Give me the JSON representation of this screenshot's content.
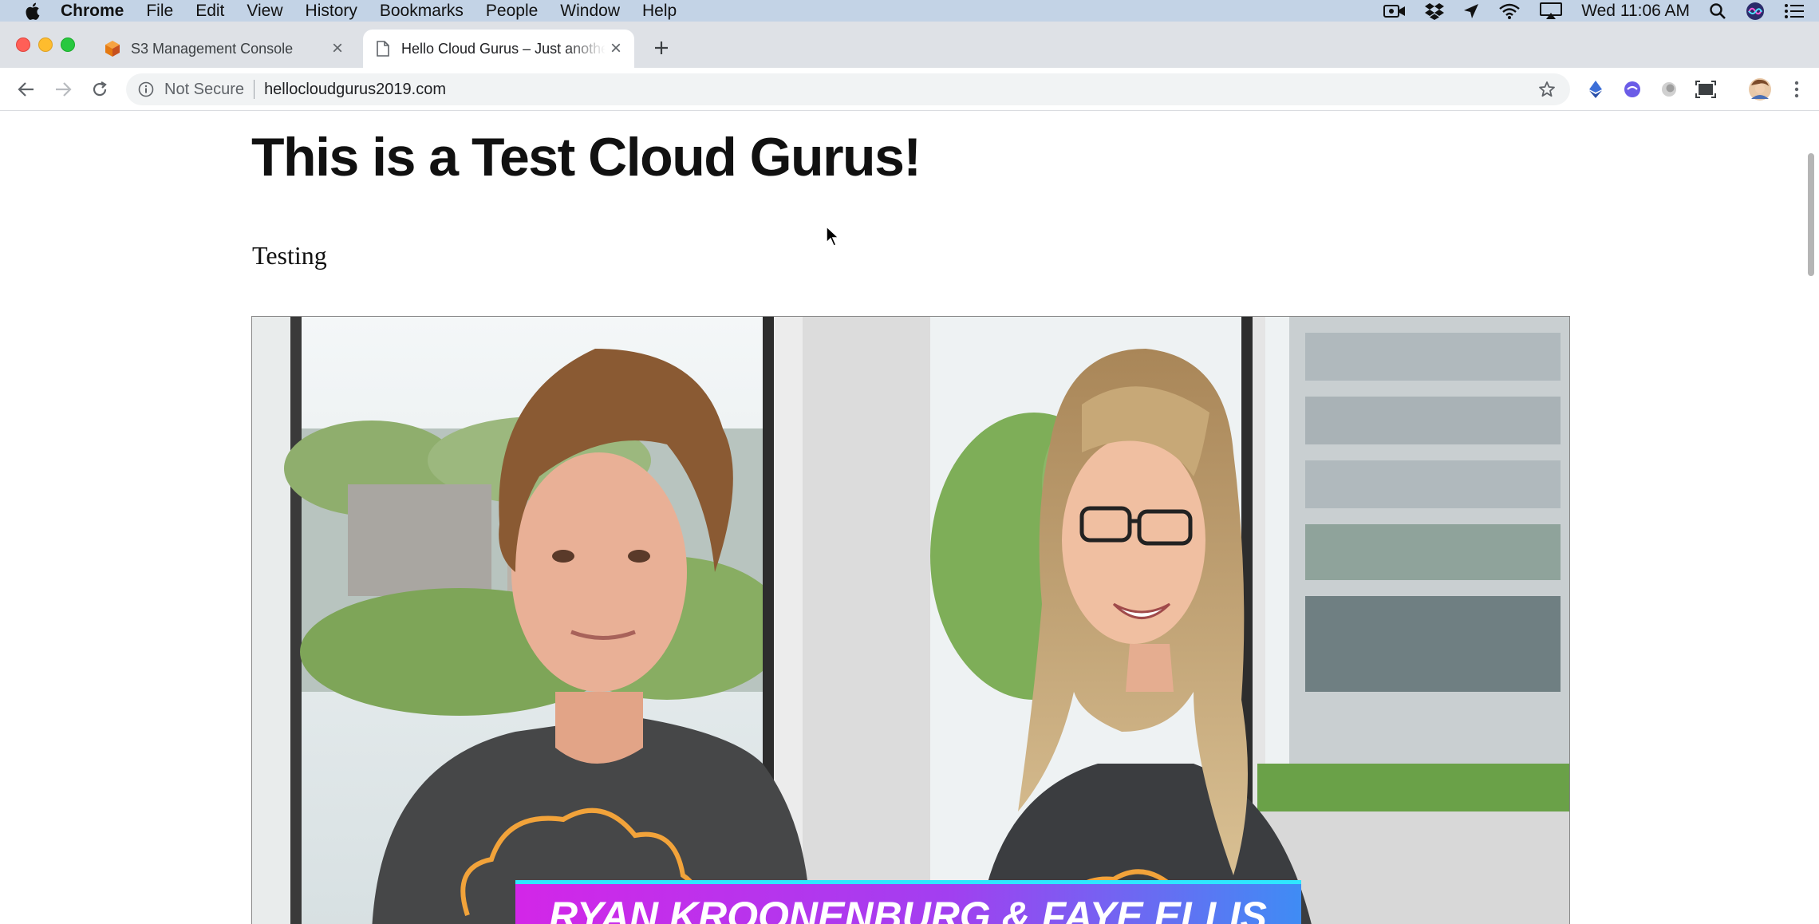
{
  "menubar": {
    "app_name": "Chrome",
    "menus": [
      "File",
      "Edit",
      "View",
      "History",
      "Bookmarks",
      "People",
      "Window",
      "Help"
    ],
    "clock": "Wed 11:06 AM",
    "status_icons": [
      "facetime-icon",
      "dropbox-icon",
      "location-icon",
      "wifi-icon",
      "airplay-icon",
      "spotlight-icon",
      "siri-icon",
      "notification-center-icon"
    ]
  },
  "tabs": [
    {
      "title": "S3 Management Console",
      "favicon": "aws-cube-icon",
      "active": false
    },
    {
      "title": "Hello Cloud Gurus – Just another",
      "favicon": "page-icon",
      "active": true
    }
  ],
  "toolbar": {
    "security_label": "Not Secure",
    "url": "hellocloudgurus2019.com"
  },
  "page": {
    "heading": "This is a Test Cloud Gurus!",
    "paragraph": "Testing",
    "banner_text": "RYAN KROONENBURG & FAYE ELLIS"
  },
  "colors": {
    "menubar_bg": "#c3d3e6",
    "tabstrip_bg": "#dee1e6",
    "banner_gradient_start": "#d326e8",
    "banner_gradient_end": "#3f8cf4",
    "cloud_logo": "#f2a33a"
  }
}
